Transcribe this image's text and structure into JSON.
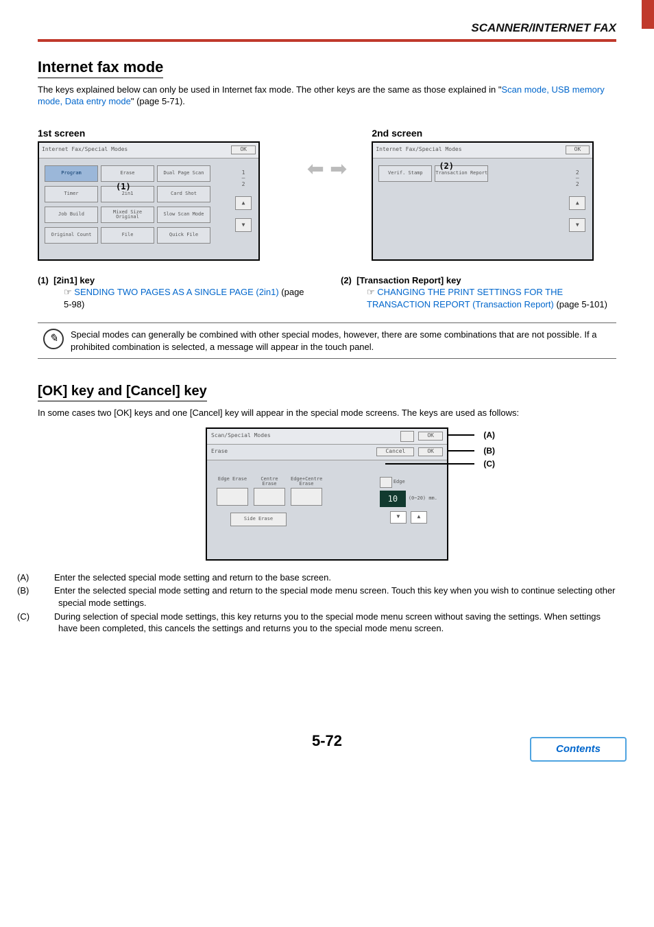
{
  "header": {
    "section_title": "SCANNER/INTERNET FAX"
  },
  "h1": "Internet fax mode",
  "intro_1": "The keys explained below can only be used in Internet fax mode. The other keys are the same as those explained in \"",
  "intro_link": "Scan mode, USB memory mode, Data entry mode",
  "intro_2": "\" (page 5-71).",
  "screen1_title": "1st screen",
  "screen2_title": "2nd screen",
  "panel1": {
    "bar": "Internet Fax/Special Modes",
    "ok": "OK",
    "buttons": [
      "Program",
      "Erase",
      "Dual Page Scan",
      "Timer",
      "2in1",
      "Card Shot",
      "Job Build",
      "Mixed Size Original",
      "Slow Scan Mode",
      "Original Count",
      "File",
      "Quick File"
    ],
    "page": "1",
    "pages": "2",
    "up": "▲",
    "down": "▼",
    "callout": "(1)"
  },
  "panel2s": {
    "bar": "Internet Fax/Special Modes",
    "ok": "OK",
    "buttons": [
      "Verif. Stamp",
      "Transaction Report"
    ],
    "page": "2",
    "pages": "2",
    "up": "▲",
    "down": "▼",
    "callout": "(2)"
  },
  "keys": {
    "k1_num": "(1)",
    "k1_title": "[2in1] key",
    "k1_link": "SENDING TWO PAGES AS A SINGLE PAGE (2in1)",
    "k1_page": "(page 5-98)",
    "k2_num": "(2)",
    "k2_title": "[Transaction Report] key",
    "k2_link": "CHANGING THE PRINT SETTINGS FOR THE TRANSACTION REPORT (Transaction Report)",
    "k2_page": "(page 5-101)"
  },
  "note": "Special modes can generally be combined with other special modes, however, there are some combinations that are not possible. If a prohibited combination is selected, a message will appear in the touch panel.",
  "h2": "[OK] key and [Cancel] key",
  "okcancel_intro": "In some cases two [OK] keys and one [Cancel] key will appear in the special mode screens. The keys are used as follows:",
  "erase_panel": {
    "row1_title": "Scan/Special Modes",
    "row1_ok": "OK",
    "row2_title": "Erase",
    "row2_cancel": "Cancel",
    "row2_ok": "OK",
    "labels": [
      "Edge Erase",
      "Centre Erase",
      "Edge+Centre Erase"
    ],
    "side_erase": "Side Erase",
    "edge_label": "Edge",
    "range": "(0~20) mm.",
    "value": "10",
    "labA": "(A)",
    "labB": "(B)",
    "labC": "(C)"
  },
  "abc": {
    "A_prefix": "(A)",
    "A": "Enter the selected special mode setting and return to the base screen.",
    "B_prefix": "(B)",
    "B": "Enter the selected special mode setting and return to the special mode menu screen. Touch this key when you wish to continue selecting other special mode settings.",
    "C_prefix": "(C)",
    "C": "During selection of special mode settings, this key returns you to the special mode menu screen without saving the settings. When settings have been completed, this cancels the settings and returns you to the special mode menu screen."
  },
  "pagenum": "5-72",
  "contents": "Contents"
}
